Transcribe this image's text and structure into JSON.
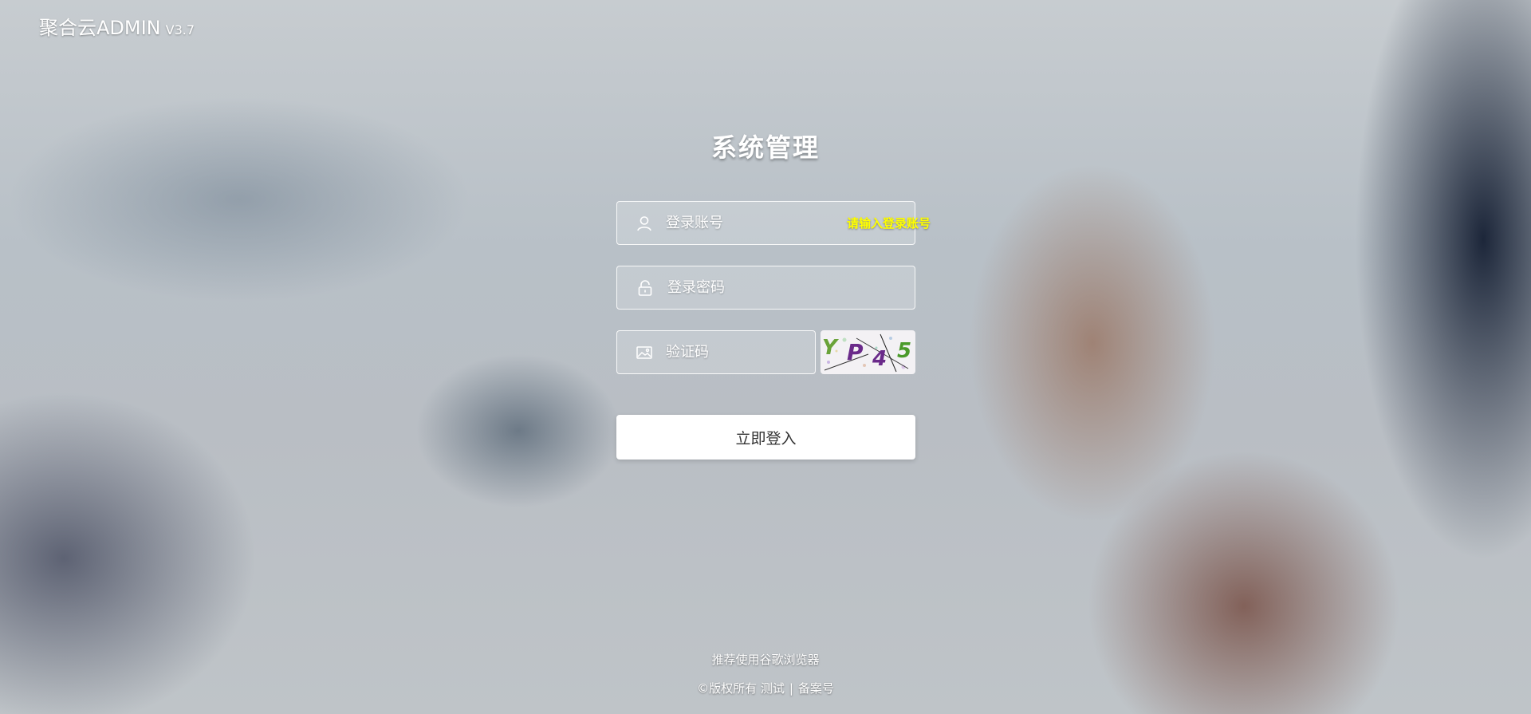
{
  "header": {
    "brand": "聚合云ADMIN",
    "version": "V3.7"
  },
  "login": {
    "title": "系统管理",
    "username": {
      "placeholder": "登录账号",
      "value": "",
      "error": "请输入登录账号",
      "icon": "user-icon"
    },
    "password": {
      "placeholder": "登录密码",
      "value": "",
      "icon": "lock-icon"
    },
    "captcha": {
      "placeholder": "验证码",
      "value": "",
      "icon": "image-icon",
      "image_text": "YP45"
    },
    "submit_label": "立即登入"
  },
  "footer": {
    "browser_tip": "推荐使用谷歌浏览器",
    "copyright": "©版权所有 测试",
    "separator": "|",
    "icp": "备案号"
  },
  "colors": {
    "error": "#ffff00",
    "button_bg": "#ffffff",
    "button_text": "#333333"
  }
}
